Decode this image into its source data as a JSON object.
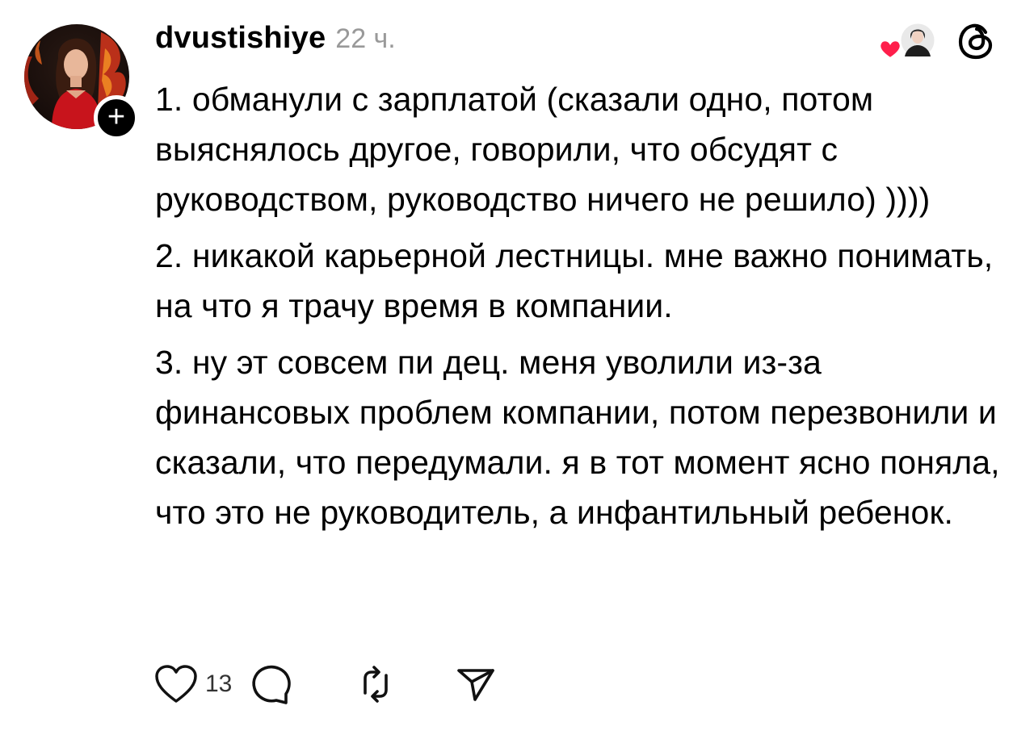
{
  "post": {
    "username": "dvustishiye",
    "time": "22 ч.",
    "paragraphs": [
      "1. обманули с зарплатой (сказали одно, потом выяснялось другое, говорили, что обсудят с руководством, руководство ничего не решило) ))))",
      "2. никакой карьерной лестницы. мне важно понимать, на что я трачу время в компании.",
      "3. ну эт совсем пи  дец. меня уволили из-за финансовых проблем компании, потом перезвонили и сказали, что передумали. я в тот момент ясно поняла, что это не руководитель, а инфантильный ребенок."
    ]
  },
  "actions": {
    "like_count": "13"
  },
  "icons": {
    "like": "heart-outline-icon",
    "comment": "speech-bubble-icon",
    "repost": "repost-icon",
    "share": "send-icon",
    "brand": "threads-logo-icon",
    "liked_by": "heart-filled-icon"
  },
  "colors": {
    "text": "#000000",
    "muted": "#999999",
    "like_red": "#ff1f4b",
    "follow_badge": "#000000"
  }
}
